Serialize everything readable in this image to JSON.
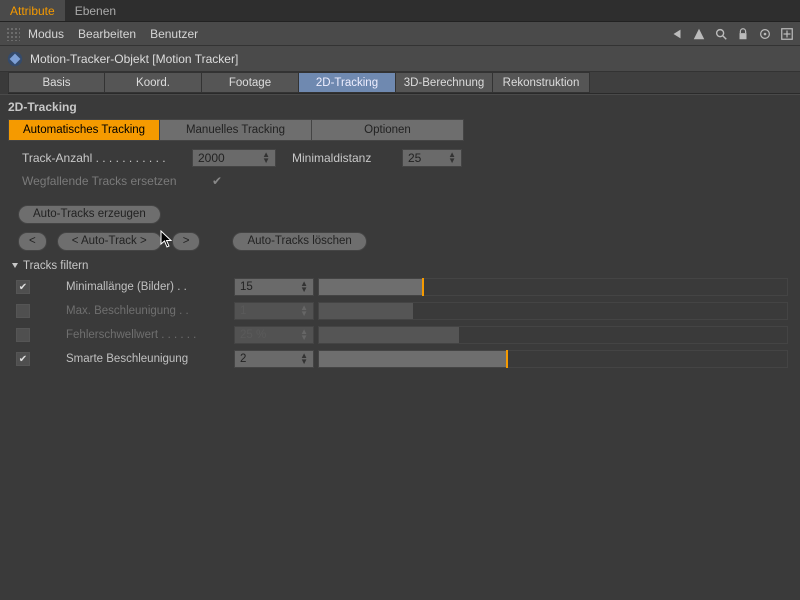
{
  "colors": {
    "accent": "#f59a00",
    "tab_active_bg": "#6f89b0"
  },
  "top_tabs": [
    "Attribute",
    "Ebenen"
  ],
  "menubar": {
    "items": [
      "Modus",
      "Bearbeiten",
      "Benutzer"
    ]
  },
  "object": {
    "title": "Motion-Tracker-Objekt [Motion Tracker]"
  },
  "section_tabs": [
    "Basis",
    "Koord.",
    "Footage",
    "2D-Tracking",
    "3D-Berechnung",
    "Rekonstruktion"
  ],
  "section_tabs_active_index": 3,
  "section_heading": "2D-Tracking",
  "sub_tabs": [
    "Automatisches Tracking",
    "Manuelles Tracking",
    "Optionen"
  ],
  "sub_tabs_active_index": 0,
  "params": {
    "track_count": {
      "label": "Track-Anzahl",
      "value": "2000"
    },
    "min_distance": {
      "label": "Minimaldistanz",
      "value": "25"
    },
    "replace_lost": {
      "label": "Wegfallende Tracks ersetzen",
      "checked": true
    }
  },
  "buttons": {
    "create_auto_tracks": "Auto-Tracks erzeugen",
    "step_back": "<",
    "auto_track": "< Auto-Track >",
    "step_fwd": ">",
    "delete_auto_tracks": "Auto-Tracks löschen"
  },
  "filters": {
    "heading": "Tracks filtern",
    "rows": [
      {
        "enabled": true,
        "label": "Minimallänge (Bilder) . .",
        "value": "15",
        "fill_pct": 22,
        "marker_pct": 22
      },
      {
        "enabled": false,
        "label": "Max. Beschleunigung . .",
        "value": "1",
        "fill_pct": 20,
        "marker_pct": null
      },
      {
        "enabled": false,
        "label": "Fehlerschwellwert . . . . . .",
        "value": "25 %",
        "fill_pct": 30,
        "marker_pct": null
      },
      {
        "enabled": true,
        "label": "Smarte Beschleunigung",
        "value": "2",
        "fill_pct": 40,
        "marker_pct": 40
      }
    ]
  }
}
